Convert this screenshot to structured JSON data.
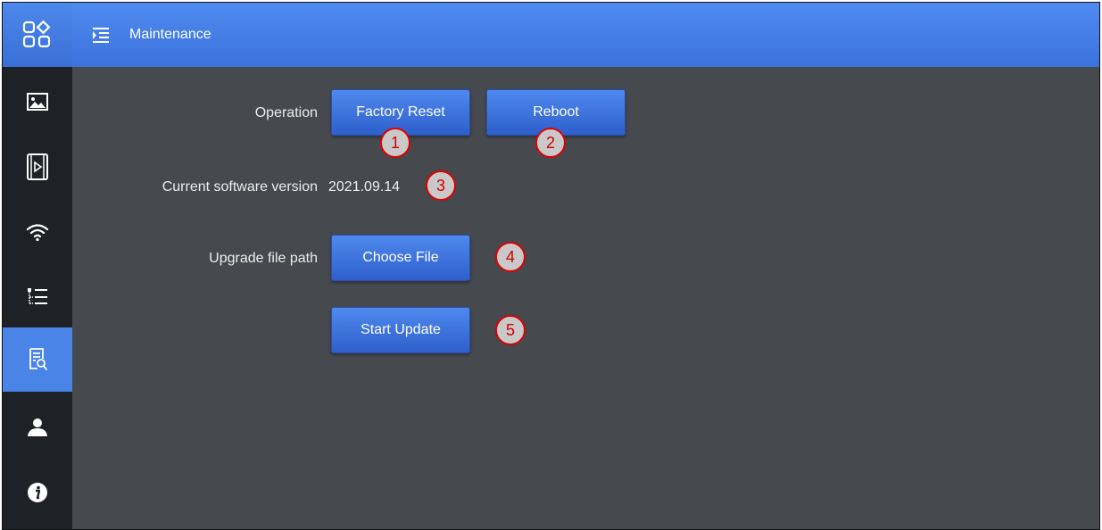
{
  "header": {
    "title": "Maintenance"
  },
  "sidebar": {
    "items": [
      {
        "name": "image",
        "active": false
      },
      {
        "name": "video",
        "active": false
      },
      {
        "name": "wifi",
        "active": false
      },
      {
        "name": "list",
        "active": false
      },
      {
        "name": "maintenance",
        "active": true
      },
      {
        "name": "user",
        "active": false
      },
      {
        "name": "info",
        "active": false
      }
    ]
  },
  "operation": {
    "label": "Operation",
    "factory_reset": "Factory Reset",
    "reboot": "Reboot"
  },
  "version": {
    "label": "Current software version",
    "value": "2021.09.14"
  },
  "upgrade": {
    "label": "Upgrade file path",
    "choose_file": "Choose File",
    "start_update": "Start Update"
  },
  "markers": [
    "1",
    "2",
    "3",
    "4",
    "5"
  ],
  "colors": {
    "accent": "#3a6fd6",
    "sidebar": "#1e2226",
    "content": "#46494d",
    "marker_border": "#e00000"
  }
}
